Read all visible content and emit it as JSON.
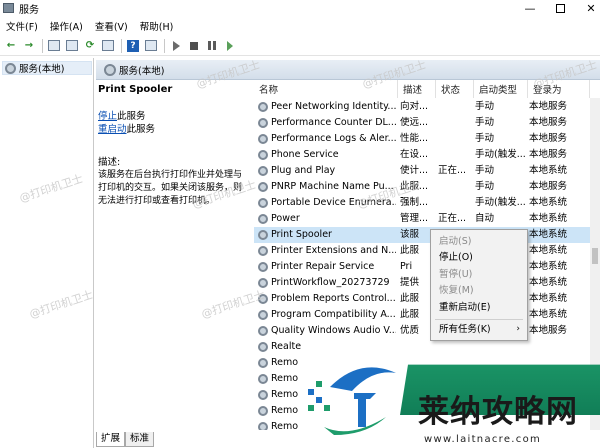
{
  "window": {
    "title": "服务"
  },
  "menu": [
    "文件(F)",
    "操作(A)",
    "查看(V)",
    "帮助(H)"
  ],
  "tree": {
    "root": "服务(本地)"
  },
  "header": {
    "title": "服务(本地)"
  },
  "details": {
    "service_name": "Print Spooler",
    "stop_link": "停止",
    "stop_suffix": "此服务",
    "restart_link": "重启动",
    "restart_suffix": "此服务",
    "desc_label": "描述:",
    "desc_text": "该服务在后台执行打印作业并处理与打印机的交互。如果关闭该服务，则无法进行打印或查看打印机。"
  },
  "columns": [
    "名称",
    "描述",
    "状态",
    "启动类型",
    "登录为"
  ],
  "rows": [
    {
      "name": "Peer Networking Identity...",
      "desc": "向对...",
      "status": "",
      "startup": "手动",
      "logon": "本地服务"
    },
    {
      "name": "Performance Counter DL...",
      "desc": "使远...",
      "status": "",
      "startup": "手动",
      "logon": "本地服务"
    },
    {
      "name": "Performance Logs & Aler...",
      "desc": "性能...",
      "status": "",
      "startup": "手动",
      "logon": "本地服务"
    },
    {
      "name": "Phone Service",
      "desc": "在设...",
      "status": "",
      "startup": "手动(触发...",
      "logon": "本地服务"
    },
    {
      "name": "Plug and Play",
      "desc": "使计...",
      "status": "正在...",
      "startup": "手动",
      "logon": "本地系统"
    },
    {
      "name": "PNRP Machine Name Pu...",
      "desc": "此服...",
      "status": "",
      "startup": "手动",
      "logon": "本地服务"
    },
    {
      "name": "Portable Device Enumera...",
      "desc": "强制...",
      "status": "",
      "startup": "手动(触发...",
      "logon": "本地系统"
    },
    {
      "name": "Power",
      "desc": "管理...",
      "status": "正在...",
      "startup": "自动",
      "logon": "本地系统"
    },
    {
      "name": "Print Spooler",
      "desc": "该服",
      "status": "",
      "startup": "",
      "logon": "本地系统"
    },
    {
      "name": "Printer Extensions and N...",
      "desc": "此服",
      "status": "",
      "startup": "",
      "logon": "本地系统"
    },
    {
      "name": "Printer Repair Service",
      "desc": "Pri",
      "status": "",
      "startup": "",
      "logon": "本地系统"
    },
    {
      "name": "PrintWorkflow_20273729",
      "desc": "提供",
      "status": "",
      "startup": "",
      "logon": "本地系统"
    },
    {
      "name": "Problem Reports Control...",
      "desc": "此服",
      "status": "",
      "startup": "",
      "logon": "本地系统"
    },
    {
      "name": "Program Compatibility A...",
      "desc": "此服",
      "status": "",
      "startup": "",
      "logon": "本地系统"
    },
    {
      "name": "Quality Windows Audio V...",
      "desc": "优质",
      "status": "",
      "startup": "",
      "logon": "本地服务"
    },
    {
      "name": "Realte",
      "desc": "",
      "status": "",
      "startup": "",
      "logon": ""
    },
    {
      "name": "Remo",
      "desc": "",
      "status": "",
      "startup": "",
      "logon": ""
    },
    {
      "name": "Remo",
      "desc": "",
      "status": "",
      "startup": "",
      "logon": ""
    },
    {
      "name": "Remo",
      "desc": "",
      "status": "",
      "startup": "",
      "logon": ""
    },
    {
      "name": "Remo",
      "desc": "",
      "status": "",
      "startup": "",
      "logon": ""
    },
    {
      "name": "Remo",
      "desc": "",
      "status": "",
      "startup": "",
      "logon": ""
    }
  ],
  "context_menu": {
    "start": "启动(S)",
    "stop": "停止(O)",
    "pause": "暂停(U)",
    "resume": "恢复(M)",
    "restart": "重新启动(E)",
    "all_tasks": "所有任务(K)",
    "submenu_arrow": "›"
  },
  "tabs": [
    "扩展",
    "标准"
  ],
  "watermark": "@打印机卫士",
  "brand": {
    "name": "莱纳攻略网",
    "url": "www.laitnacre.com",
    "colors": {
      "green": "#1e9c6b",
      "blue": "#1c6fc4"
    }
  },
  "icons": {
    "gear": "gear-icon",
    "help": "help-icon"
  }
}
